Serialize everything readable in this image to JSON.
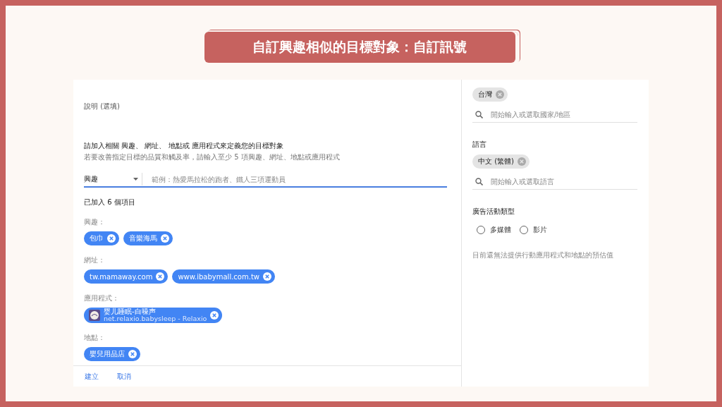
{
  "title": "自訂興趣相似的目標對象：自訂訊號",
  "description_label": "說明 (選填)",
  "instruction": "請加入相關 興趣、 網址、 地點或 應用程式來定義您的目標對象",
  "hint": "若要改善指定目標的品質和觸及率，請輸入至少 5 項興趣、網址、地點或應用程式",
  "type_select": {
    "value": "興趣"
  },
  "search": {
    "placeholder": "範例：熱愛馬拉松的跑者、鐵人三項運動員"
  },
  "added_count": "已加入 6 個項目",
  "groups": [
    {
      "label": "興趣：",
      "chips": [
        {
          "kind": "text",
          "label": "包巾"
        },
        {
          "kind": "text",
          "label": "音樂海馬"
        }
      ]
    },
    {
      "label": "網址：",
      "chips": [
        {
          "kind": "text",
          "label": "tw.mamaway.com"
        },
        {
          "kind": "text",
          "label": "www.ibabymall.com.tw"
        }
      ]
    },
    {
      "label": "應用程式：",
      "chips": [
        {
          "kind": "app",
          "label": "婴儿睡眠-白噪声",
          "sublabel": "net.relaxio.babysleep - Relaxio"
        }
      ]
    },
    {
      "label": "地點：",
      "chips": [
        {
          "kind": "text",
          "label": "嬰兒用品店"
        }
      ]
    }
  ],
  "buttons": [
    "建立",
    "取消"
  ],
  "location": {
    "chips": [
      "台灣"
    ],
    "placeholder": "開始輸入或選取國家/地區"
  },
  "language": {
    "label": "語言",
    "chips": [
      "中文 (繁體)"
    ],
    "placeholder": "開始輸入或選取語言"
  },
  "campaign_type": {
    "label": "廣告活動類型",
    "options": [
      {
        "label": "多媒體",
        "selected": false
      },
      {
        "label": "影片",
        "selected": false
      }
    ]
  },
  "note": "目前還無法提供行動應用程式和地點的預估值"
}
